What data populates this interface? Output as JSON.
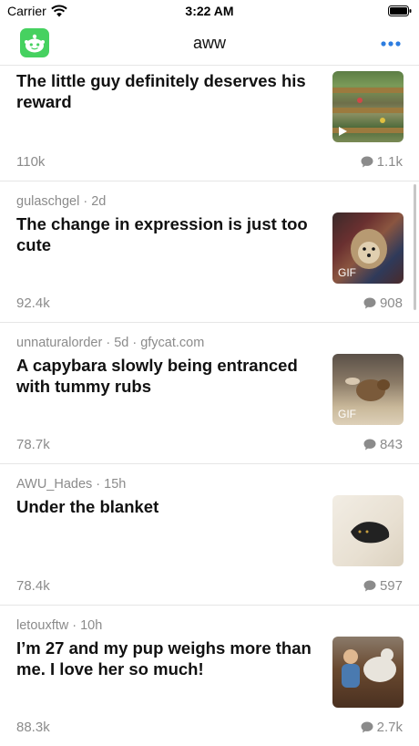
{
  "status_bar": {
    "carrier": "Carrier",
    "time": "3:22 AM"
  },
  "nav": {
    "title": "aww",
    "app_icon": "reddit-alien-icon",
    "more_icon": "more-dots-icon",
    "accent": "#2d7de0"
  },
  "posts": [
    {
      "meta": "",
      "title": "The little guy definitely deserves his reward",
      "votes": "110k",
      "comments": "1.1k",
      "thumb_label": ""
    },
    {
      "meta": "gulaschgel · 2d",
      "title": "The change in expression is just too cute",
      "votes": "92.4k",
      "comments": "908",
      "thumb_label": "GIF"
    },
    {
      "meta": "unnaturalorder · 5d · gfycat.com",
      "title": "A capybara slowly being entranced with tummy rubs",
      "votes": "78.7k",
      "comments": "843",
      "thumb_label": "GIF"
    },
    {
      "meta": "AWU_Hades · 15h",
      "title": "Under the blanket",
      "votes": "78.4k",
      "comments": "597",
      "thumb_label": ""
    },
    {
      "meta": "letouxftw · 10h",
      "title": "I’m 27 and my pup weighs more than me. I love her so much!",
      "votes": "88.3k",
      "comments": "2.7k",
      "thumb_label": ""
    }
  ]
}
